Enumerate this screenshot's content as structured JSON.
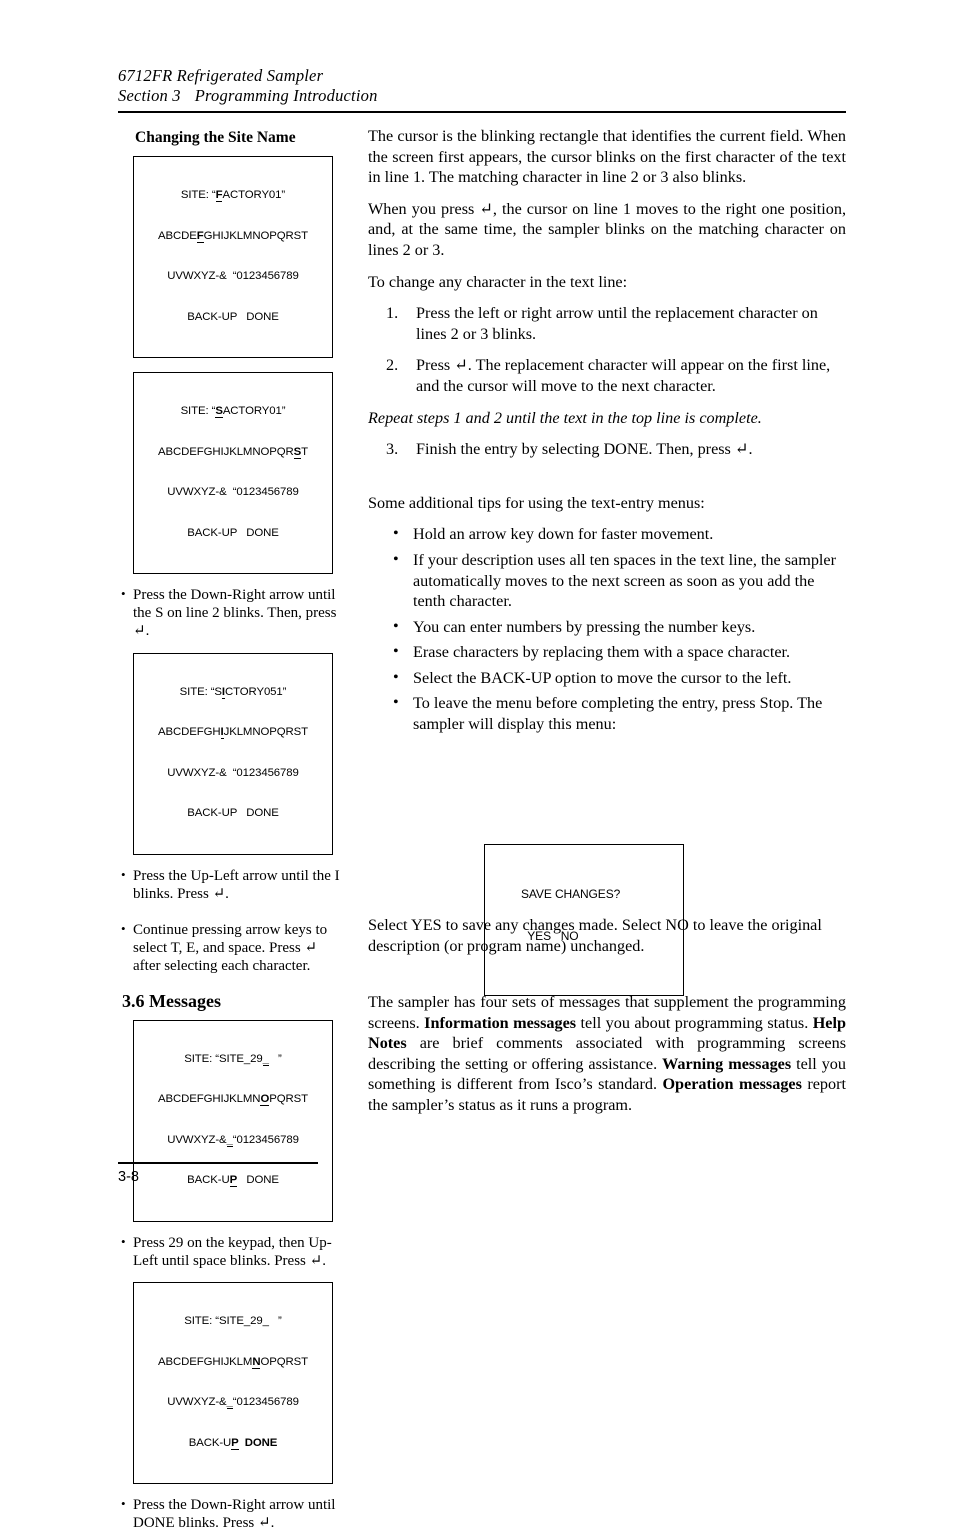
{
  "header": {
    "line1": "6712FR Refrigerated Sampler",
    "section_label": "Section 3",
    "section_title": "Programming Introduction"
  },
  "left_column": {
    "heading": "Changing the Site Name",
    "screens": [
      {
        "name": "screen-factory01",
        "line1_pre": "SITE: “",
        "line1_cursor": "F",
        "line1_post": "ACTORY01”",
        "line2_pre": "ABCDE",
        "line2_cursor": "F",
        "line2_post": "GHIJKLMNOPQRST",
        "line3": "UVWXYZ-&  “0123456789",
        "line4_a": "BACK-UP",
        "line4_b": "DONE"
      },
      {
        "name": "screen-sactory01",
        "line1_pre": "SITE: “",
        "line1_cursor": "S",
        "line1_post": "ACTORY01”",
        "line2_pre": "ABCDEFGHIJKLMNOPQR",
        "line2_cursor": "S",
        "line2_post": "T",
        "line3": "UVWXYZ-&  “0123456789",
        "line4_a": "BACK-UP",
        "line4_b": "DONE"
      },
      {
        "name": "screen-sictory051",
        "line1_pre": "SITE: “S",
        "line1_cursor": "I",
        "line1_post": "CTORY051”",
        "line2_pre": "ABCDEFGH",
        "line2_cursor": "I",
        "line2_post": "JKLMNOPQRST",
        "line3": "UVWXYZ-&  “0123456789",
        "line4_a": "BACK-UP",
        "line4_b": "DONE"
      },
      {
        "name": "screen-site29-space",
        "line1_pre": "SITE: “SITE_29",
        "line1_cursor": "_",
        "line1_post": "   ”",
        "line2_pre": "ABCDEFGHIJKLMN",
        "line2_cursor": "O",
        "line2_post": "PQRST",
        "line3_pre": "UVWXYZ-&",
        "line3_cursor": "_",
        "line3_post": "“0123456789",
        "line4_a_pre": "BACK-U",
        "line4_a_cursor": "P",
        "line4_b": "DONE"
      },
      {
        "name": "screen-site29-done",
        "line1_pre": "SITE: “SITE_29_",
        "line1_cursor": "",
        "line1_post": "   ”",
        "line2_pre": "ABCDEFGHIJKLM",
        "line2_cursor": "N",
        "line2_post": "OPQRST",
        "line3_pre": "UVWXYZ-&",
        "line3_cursor": "_",
        "line3_post": "“0123456789",
        "line4_a_pre": "BACK-U",
        "line4_a_cursor": "P",
        "line4_b_selected": "DONE"
      }
    ],
    "notes": [
      "Press the Down-Right arrow until the S on line 2 blinks. Then, press ↵.",
      "Press the Up-Left arrow until the I blinks. Press ↵.",
      "Continue pressing arrow keys to select  T, E, and space. Press ↵ after selecting each character.",
      "Press 29 on the keypad, then Up-Left until space blinks. Press ↵.",
      "Press the Down-Right arrow until DONE blinks. Press ↵."
    ]
  },
  "right_column": {
    "para1": "The cursor is the blinking rectangle that identifies the current field. When the screen first appears, the cursor blinks on the first character of the text in line 1. The matching character in line 2 or 3 also blinks.",
    "para2": "When you press ↵, the cursor on line 1 moves to the right one position, and, at the same time, the sampler blinks on the matching character on lines 2 or 3.",
    "para3": "To change any character in the text line:",
    "steps": [
      {
        "num": "1.",
        "text": "Press the left or right arrow until the replacement character on lines 2 or 3 blinks."
      },
      {
        "num": "2.",
        "text": "Press ↵. The replacement character will appear on the first line, and the cursor will move to the next character."
      }
    ],
    "repeat_note": "Repeat steps 1 and 2 until the text in the top line is complete.",
    "step3": {
      "num": "3.",
      "text": "Finish the entry by selecting DONE. Then, press ↵."
    },
    "tips_intro": "Some additional tips for using the text-entry menus:",
    "tips": [
      "Hold an arrow key down for faster movement.",
      "If your description uses all ten spaces in the text line, the sampler automatically moves to the next screen as soon as you add the tenth character.",
      "You can enter numbers by pressing the number keys.",
      "Erase characters by replacing them with a space character.",
      "Select the BACK-UP option to move the cursor to the left.",
      "To leave the menu before completing the entry, press Stop. The sampler will display this menu:"
    ],
    "save_screen": {
      "name": "screen-save-changes",
      "line1": "SAVE CHANGES?",
      "line2_yes": "YES",
      "line2_no": "NO"
    },
    "after_save_text": "Select YES to save any changes made. Select NO to leave the original description (or program name) unchanged."
  },
  "messages_section": {
    "number_title": "3.6  Messages",
    "body_1": "The sampler has four sets of messages that supplement the programming screens. ",
    "bold_1": "Information messages",
    "body_2": " tell you about programming status. ",
    "bold_2": "Help Notes",
    "body_3": " are brief comments associated with programming screens describing the setting or offering assistance. ",
    "bold_3": "Warning messages",
    "body_4": " tell you something is different from Isco’s standard. ",
    "bold_4": "Operation messages",
    "body_5": " report the sampler’s status as it runs a program."
  },
  "footer": {
    "page_number": "3-8"
  }
}
